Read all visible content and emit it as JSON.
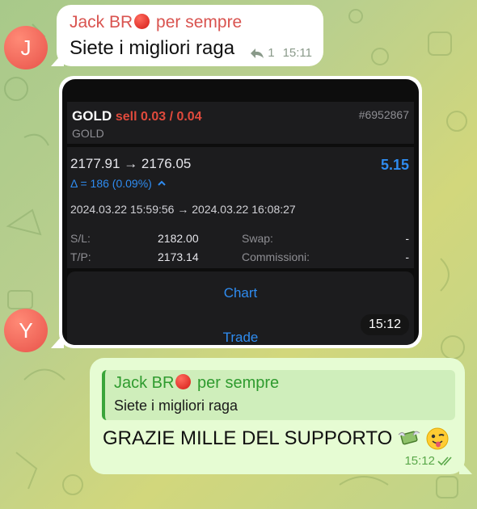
{
  "messages": [
    {
      "sender_name": "Jack BR",
      "sender_suffix": "per sempre",
      "avatar_letter": "J",
      "text": "Siete i migliori raga",
      "reply_count": "1",
      "time": "15:11"
    },
    {
      "avatar_letter": "Y",
      "time": "15:12",
      "screenshot": {
        "symbol": "GOLD",
        "side": "sell 0.03 / 0.04",
        "symbol_sub": "GOLD",
        "ticket": "#6952867",
        "price_from": "2177.91",
        "price_to": "2176.05",
        "profit": "5.15",
        "delta": "Δ = 186 (0.09%)",
        "date_from": "2024.03.22 15:59:56",
        "date_to": "2024.03.22 16:08:27",
        "sl_label": "S/L:",
        "sl_value": "2182.00",
        "swap_label": "Swap:",
        "swap_value": "-",
        "tp_label": "T/P:",
        "tp_value": "2173.14",
        "commission_label": "Commissioni:",
        "commission_value": "-",
        "chart_button": "Chart",
        "trade_button": "Trade"
      }
    },
    {
      "quote_sender_name": "Jack BR",
      "quote_sender_suffix": "per sempre",
      "quote_text": "Siete i migliori raga",
      "text": "GRAZIE MILLE DEL SUPPORTO",
      "time": "15:12"
    }
  ],
  "icons": [
    "red-circle-emoji",
    "reply-icon",
    "money-wings-emoji",
    "winking-tongue-emoji",
    "double-check-icon",
    "chevron-up-icon"
  ],
  "colors": {
    "incoming_bubble": "#ffffff",
    "outgoing_bubble": "#e6fcd3",
    "sender_red": "#d9534f",
    "quote_green": "#2f9b2f",
    "sell_red": "#e04a3c",
    "profit_blue": "#2f8cf0"
  }
}
